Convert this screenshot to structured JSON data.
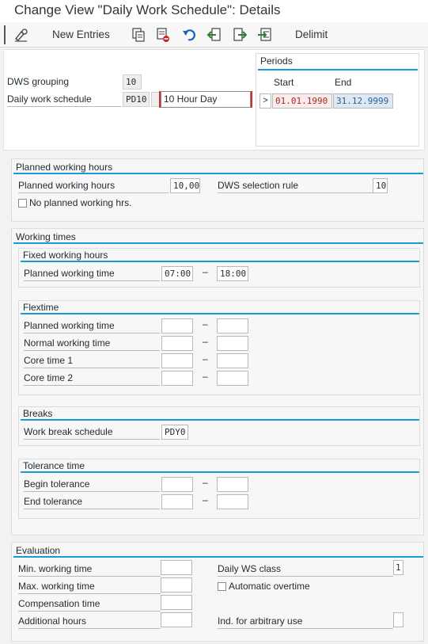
{
  "title": "Change View \"Daily Work Schedule\": Details",
  "toolbar": {
    "new_entries": "New Entries",
    "delimit": "Delimit"
  },
  "header": {
    "dws_grouping_label": "DWS grouping",
    "dws_grouping_value": "10",
    "daily_work_schedule_label": "Daily work schedule",
    "daily_work_schedule_code": "PD10",
    "daily_work_schedule_text": "10 Hour Day"
  },
  "periods": {
    "title": "Periods",
    "start_label": "Start",
    "end_label": "End",
    "nav_glyph": ">",
    "start_value": "01.01.1990",
    "end_value": "31.12.9999"
  },
  "planned_working_hours": {
    "title": "Planned working hours",
    "hours_label": "Planned working hours",
    "hours_value": "10,00",
    "dws_rule_label": "DWS selection rule",
    "dws_rule_value": "10",
    "no_planned_label": "No planned working hrs."
  },
  "working_times": {
    "title": "Working times",
    "fixed": {
      "title": "Fixed working hours",
      "planned_label": "Planned working time",
      "from": "07:00",
      "to": "18:00"
    },
    "flextime": {
      "title": "Flextime",
      "planned_label": "Planned working time",
      "normal_label": "Normal working time",
      "core1_label": "Core time 1",
      "core2_label": "Core time 2"
    },
    "breaks": {
      "title": "Breaks",
      "schedule_label": "Work break schedule",
      "schedule_value": "PDY0"
    },
    "tolerance": {
      "title": "Tolerance time",
      "begin_label": "Begin tolerance",
      "end_label": "End tolerance"
    },
    "dash": "–"
  },
  "evaluation": {
    "title": "Evaluation",
    "min_label": "Min. working time",
    "max_label": "Max. working time",
    "comp_label": "Compensation time",
    "additional_label": "Additional hours",
    "daily_ws_class_label": "Daily WS class",
    "daily_ws_class_value": "1",
    "auto_overtime_label": "Automatic overtime",
    "arbitrary_label": "Ind. for arbitrary use"
  }
}
